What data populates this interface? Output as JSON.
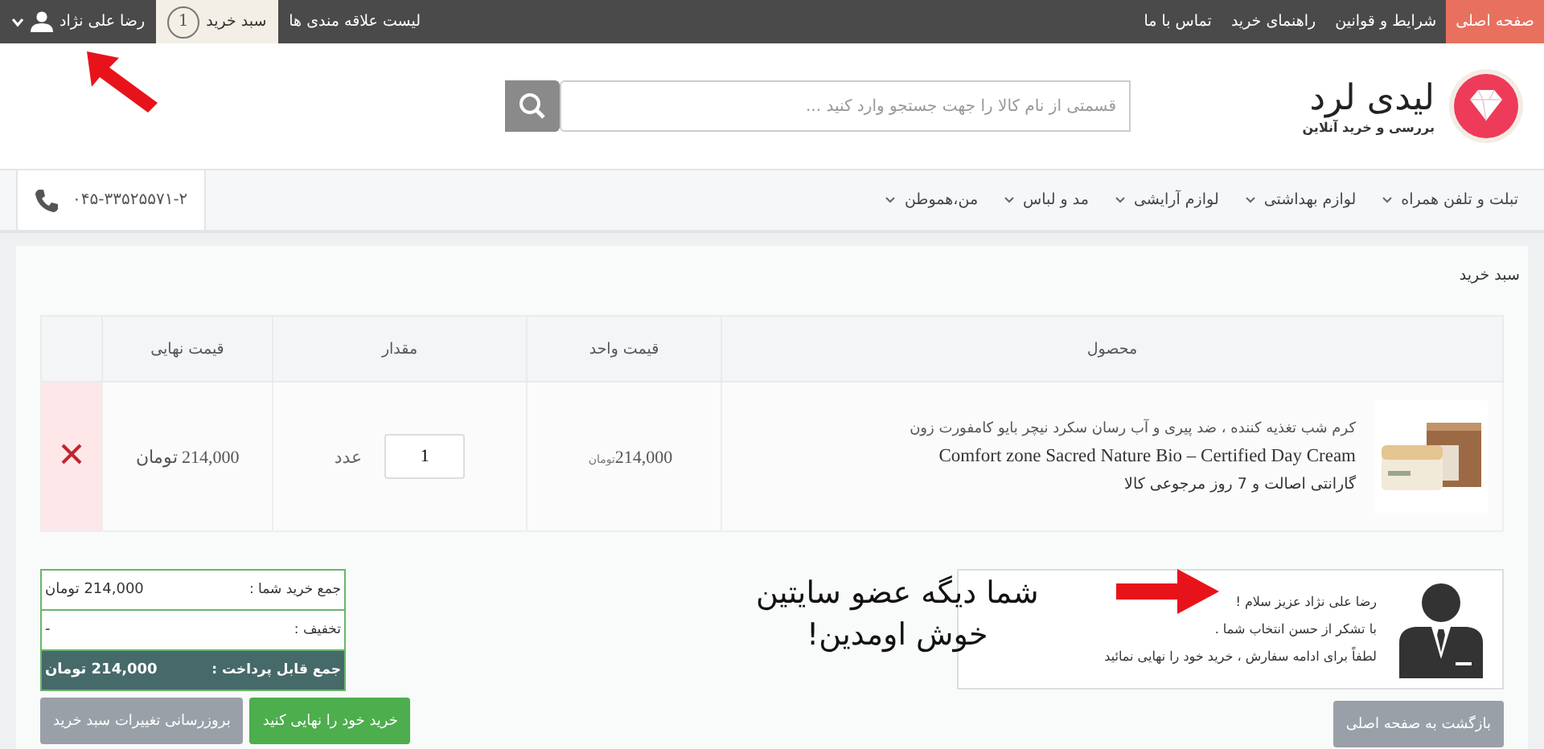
{
  "top_bar": {
    "nav": [
      {
        "label": "صفحه اصلی",
        "selected": true
      },
      {
        "label": "شرایط و قوانین",
        "selected": false
      },
      {
        "label": "راهنمای خرید",
        "selected": false
      },
      {
        "label": "تماس با ما",
        "selected": false
      }
    ],
    "account": [
      {
        "kind": "link",
        "label": "لیست علاقه مندی ها",
        "selected": false
      },
      {
        "kind": "cart",
        "label": "سبد خرید",
        "count": "1",
        "selected": true
      },
      {
        "kind": "user",
        "label": "رضا علی نژاد",
        "selected": false
      }
    ]
  },
  "header": {
    "logo_title": "لیدی لرد",
    "logo_subtitle": "بررسی و خرید آنلاین",
    "search": {
      "placeholder": "قسمتی از نام کالا را جهت جستجو وارد کنید ..."
    }
  },
  "categories": [
    "تبلت و تلفن همراه",
    "لوازم بهداشتی",
    "لوازم آرایشی",
    "مد و لباس",
    "من،هموطن"
  ],
  "phone": "۰۴۵-۳۳۵۲۵۵۷۱-۲",
  "cart": {
    "title": "سبد خرید",
    "columns": [
      "محصول",
      "قیمت واحد",
      "مقدار",
      "قیمت نهایی"
    ],
    "rows": [
      {
        "name_fa": "کرم شب تغذیه کننده ، ضد پیری و آب رسان سکرد نیچر بایو کامفورت زون",
        "name_en": "Comfort zone Sacred Nature Bio – Certified Day Cream",
        "guarantee": "گارانتی اصالت و 7 روز مرجوعی کالا",
        "unit_price": "214,000",
        "unit_currency": "تومان",
        "quantity": "1",
        "unit": "عدد",
        "final_price": "214,000 تومان"
      }
    ]
  },
  "welcome": {
    "lines": [
      "رضا علی نژاد عزیز سلام !",
      "با تشکر از حسن انتخاب شما .",
      "لطفاً برای ادامه سفارش ، خرید خود را نهایی نمائید"
    ],
    "back_button": "بازگشت به صفحه اصلی"
  },
  "summary": {
    "rows": [
      {
        "kind": "plain",
        "label": "جمع خرید شما :",
        "value": "214,000 تومان"
      },
      {
        "kind": "plain",
        "label": "تخفیف :",
        "value": "-"
      },
      {
        "kind": "total",
        "label": "جمع قابل پرداخت :",
        "value": "214,000 تومان"
      }
    ],
    "buttons": [
      {
        "kind": "primary",
        "label": "خرید خود را نهایی کنید"
      },
      {
        "kind": "secondary",
        "label": "بروزرسانی تغییرات سبد خرید"
      }
    ]
  },
  "annotation": {
    "lines": [
      "شما دیگه عضو سایتین",
      "خوش اومدین!"
    ]
  }
}
